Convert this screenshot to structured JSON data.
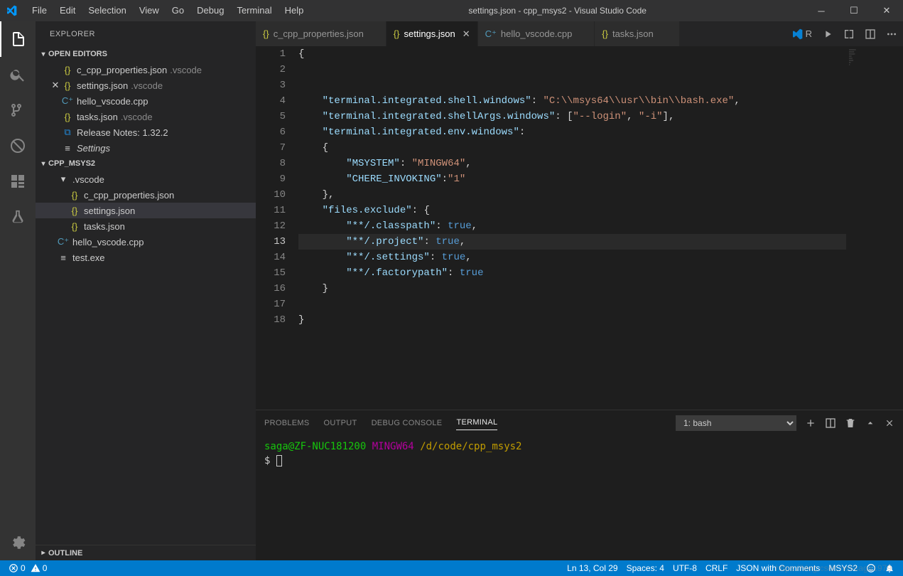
{
  "window": {
    "title": "settings.json - cpp_msys2 - Visual Studio Code"
  },
  "menu": [
    "File",
    "Edit",
    "Selection",
    "View",
    "Go",
    "Debug",
    "Terminal",
    "Help"
  ],
  "sidebar": {
    "title": "EXPLORER",
    "openEditorsLabel": "OPEN EDITORS",
    "projectLabel": "CPP_MSYS2",
    "outlineLabel": "OUTLINE",
    "openEditors": [
      {
        "name": "c_cpp_properties.json",
        "desc": ".vscode",
        "iconClass": "ico-json",
        "glyph": "{}"
      },
      {
        "name": "settings.json",
        "desc": ".vscode",
        "iconClass": "ico-json",
        "glyph": "{}",
        "modified": true
      },
      {
        "name": "hello_vscode.cpp",
        "desc": "",
        "iconClass": "ico-cpp",
        "glyph": "C⁺"
      },
      {
        "name": "tasks.json",
        "desc": ".vscode",
        "iconClass": "ico-json",
        "glyph": "{}"
      },
      {
        "name": "Release Notes: 1.32.2",
        "desc": "",
        "iconClass": "ico-vscode",
        "glyph": "⧉"
      },
      {
        "name": "Settings",
        "desc": "",
        "iconClass": "ico-settings",
        "glyph": "≡"
      }
    ],
    "tree": [
      {
        "name": ".vscode",
        "type": "folder",
        "indent": 1,
        "expanded": true
      },
      {
        "name": "c_cpp_properties.json",
        "type": "file",
        "indent": 2,
        "iconClass": "ico-json",
        "glyph": "{}"
      },
      {
        "name": "settings.json",
        "type": "file",
        "indent": 2,
        "iconClass": "ico-json",
        "glyph": "{}",
        "active": true
      },
      {
        "name": "tasks.json",
        "type": "file",
        "indent": 2,
        "iconClass": "ico-json",
        "glyph": "{}"
      },
      {
        "name": "hello_vscode.cpp",
        "type": "file",
        "indent": 1,
        "iconClass": "ico-cpp",
        "glyph": "C⁺"
      },
      {
        "name": "test.exe",
        "type": "file",
        "indent": 1,
        "iconClass": "ico-file",
        "glyph": "≡"
      }
    ]
  },
  "tabs": [
    {
      "name": "c_cpp_properties.json",
      "iconClass": "ico-json",
      "glyph": "{}"
    },
    {
      "name": "settings.json",
      "iconClass": "ico-json",
      "glyph": "{}",
      "active": true
    },
    {
      "name": "hello_vscode.cpp",
      "iconClass": "ico-cpp",
      "glyph": "C⁺"
    },
    {
      "name": "tasks.json",
      "iconClass": "ico-json",
      "glyph": "{}"
    }
  ],
  "tabsActions": {
    "runLabel": "R"
  },
  "editor": {
    "currentLine": 13,
    "lines": [
      "{",
      "",
      "",
      "    \"terminal.integrated.shell.windows\": \"C:\\\\msys64\\\\usr\\\\bin\\\\bash.exe\",",
      "    \"terminal.integrated.shellArgs.windows\": [\"--login\", \"-i\"],",
      "    \"terminal.integrated.env.windows\":",
      "    {",
      "        \"MSYSTEM\": \"MINGW64\",",
      "        \"CHERE_INVOKING\":\"1\"",
      "    },",
      "    \"files.exclude\": {",
      "        \"**/.classpath\": true,",
      "        \"**/.project\": true,",
      "        \"**/.settings\": true,",
      "        \"**/.factorypath\": true",
      "    }",
      "",
      "}"
    ]
  },
  "panel": {
    "tabs": [
      "PROBLEMS",
      "OUTPUT",
      "DEBUG CONSOLE",
      "TERMINAL"
    ],
    "active": 3,
    "selector": "1: bash",
    "terminal": {
      "user": "saga@ZF-NUC181200",
      "env": "MINGW64",
      "cwd": "/d/code/cpp_msys2",
      "prompt": "$"
    }
  },
  "statusbar": {
    "errors": "0",
    "warnings": "0",
    "lncol": "Ln 13, Col 29",
    "spaces": "Spaces: 4",
    "encoding": "UTF-8",
    "eol": "CRLF",
    "lang": "JSON with Comments",
    "term": "MSYS2"
  },
  "watermark": "https://blog.csdn.net/saga1979"
}
